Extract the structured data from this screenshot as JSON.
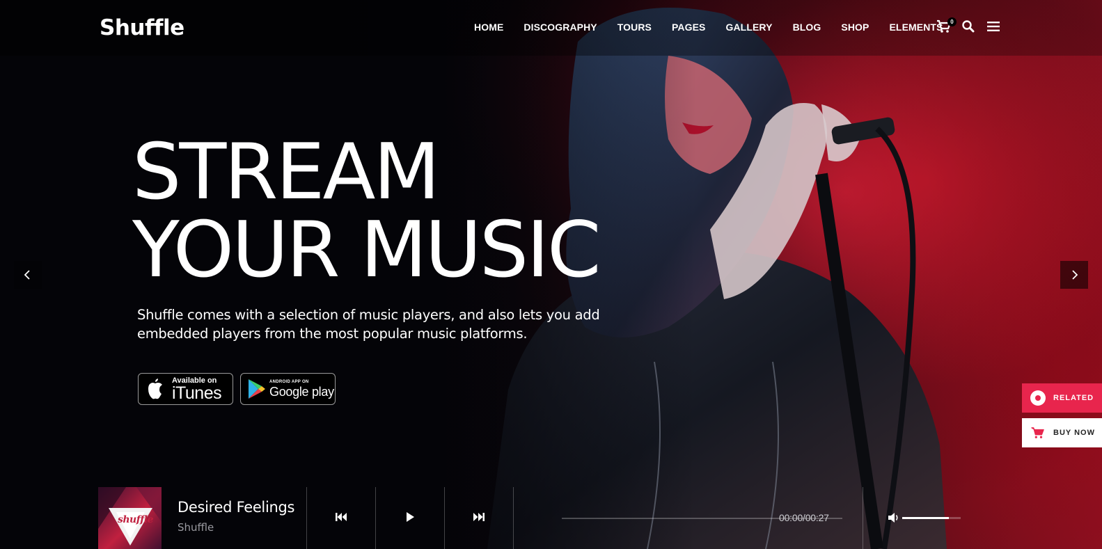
{
  "brand": {
    "logo": "Shuffle"
  },
  "nav": {
    "items": [
      "HOME",
      "DISCOGRAPHY",
      "TOURS",
      "PAGES",
      "GALLERY",
      "BLOG",
      "SHOP",
      "ELEMENTS"
    ],
    "cart_count": "0",
    "icons": [
      "cart-icon",
      "search-icon",
      "menu-icon"
    ]
  },
  "hero": {
    "headline_line1": "STREAM",
    "headline_line2": "YOUR MUSIC",
    "description_line1": "Shuffle comes with a selection of music players, and also lets you add",
    "description_line2": "embedded players from the most popular music platforms.",
    "itunes": {
      "small": "Available on",
      "big": "iTunes"
    },
    "google": {
      "small": "ANDROID APP ON",
      "big": "Google play"
    }
  },
  "side": {
    "related": "RELATED",
    "buy_now": "BUY NOW"
  },
  "player": {
    "cover_text": "shuffle",
    "title": "Desired Feelings",
    "artist": "Shuffle",
    "time": "00:00/00:27",
    "progress": 0,
    "volume": 0.8
  },
  "colors": {
    "accent": "#e8254d",
    "background": "#050507"
  }
}
